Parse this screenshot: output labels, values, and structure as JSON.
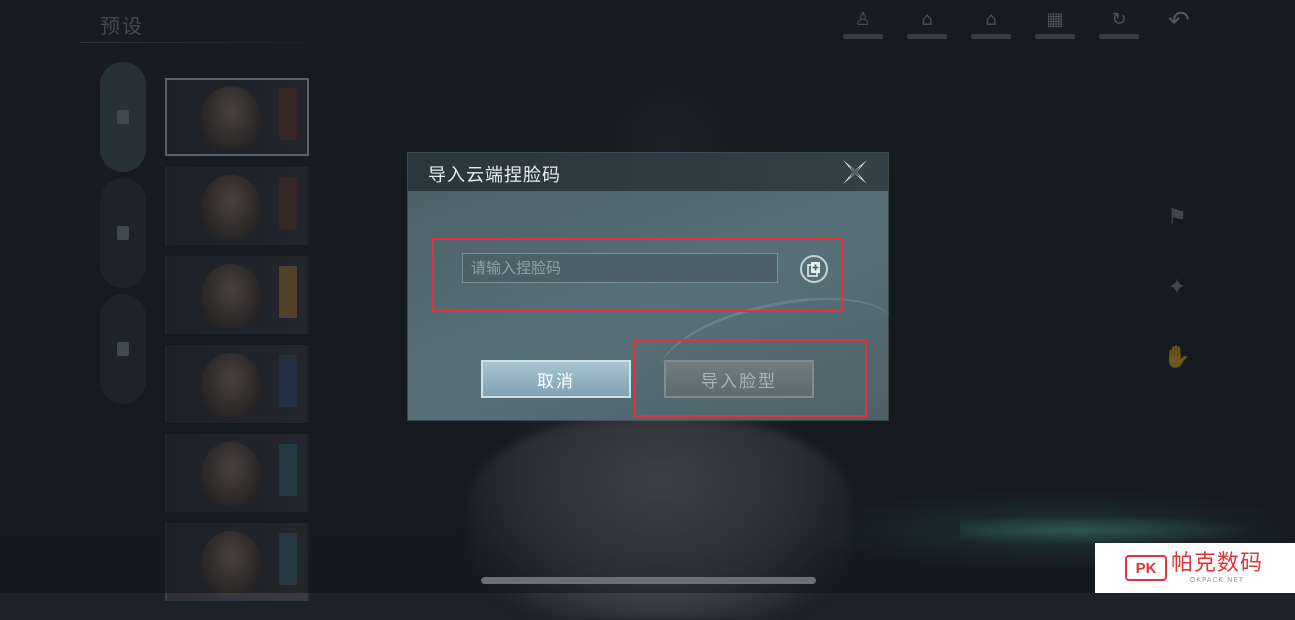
{
  "screen": {
    "section_title": "预设",
    "toolbar_icons": [
      "bust-icon",
      "house-icon",
      "house-icon",
      "grid-icon",
      "refresh-icon"
    ],
    "back_icon": "back-arrow-icon",
    "category_tab_count": 3,
    "preset_count": 6,
    "side_icons": [
      "tie-icon",
      "spark-icon",
      "hand-icon"
    ]
  },
  "dialog": {
    "title": "导入云端捏脸码",
    "close_icon": "ornate-close-icon",
    "code_input": {
      "value": "",
      "placeholder": "请输入捏脸码"
    },
    "paste_icon": "paste-icon",
    "cancel_label": "取消",
    "import_label": "导入脸型",
    "import_enabled": false
  },
  "watermark": {
    "logo": "PK",
    "name": "帕克数码",
    "url": "OKPACK.NET"
  },
  "colors": {
    "annotation": "#e0333a",
    "dialog_bg": "#587079",
    "cancel_button": "#8fb0bf",
    "import_button_disabled": "#66737a"
  }
}
